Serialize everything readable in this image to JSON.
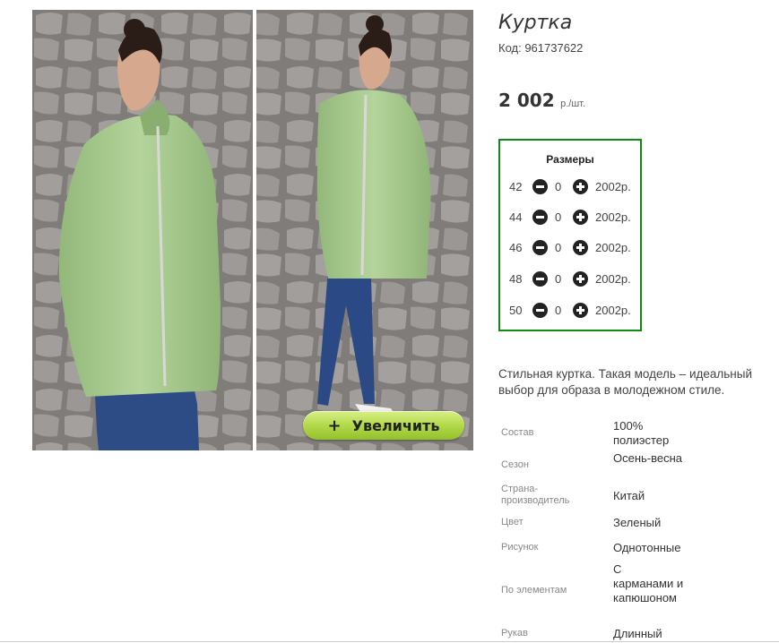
{
  "product": {
    "title": "Куртка",
    "sku": "Код: 961737622",
    "price_amount": "2 002",
    "price_unit": "р./шт."
  },
  "gallery": {
    "zoom_plus": "+",
    "zoom_label": "Увеличить"
  },
  "sizes": {
    "title": "Размеры",
    "rows": [
      {
        "size": "42",
        "qty": "0",
        "price": "2002р."
      },
      {
        "size": "44",
        "qty": "0",
        "price": "2002р."
      },
      {
        "size": "46",
        "qty": "0",
        "price": "2002р."
      },
      {
        "size": "48",
        "qty": "0",
        "price": "2002р."
      },
      {
        "size": "50",
        "qty": "0",
        "price": "2002р."
      }
    ]
  },
  "description": "Стильная куртка. Такая модель – идеальный выбор для образа в молодежном стиле.",
  "properties": [
    {
      "name": "Состав",
      "value": "100% полиэстер"
    },
    {
      "name": "Сезон",
      "value": "Осень-весна"
    },
    {
      "name": "Страна-производитель",
      "value": "Китай"
    },
    {
      "name": "Цвет",
      "value": "Зеленый"
    },
    {
      "name": "Рисунок",
      "value": "Однотонные"
    },
    {
      "name": "По элементам",
      "value": "С карманами и капюшоном"
    },
    {
      "name": "Рукав",
      "value": "Длинный"
    }
  ],
  "colors": {
    "size_box_border": "#118a11",
    "jacket": "#a6c98c",
    "zoom_button": "#b2d94a"
  }
}
